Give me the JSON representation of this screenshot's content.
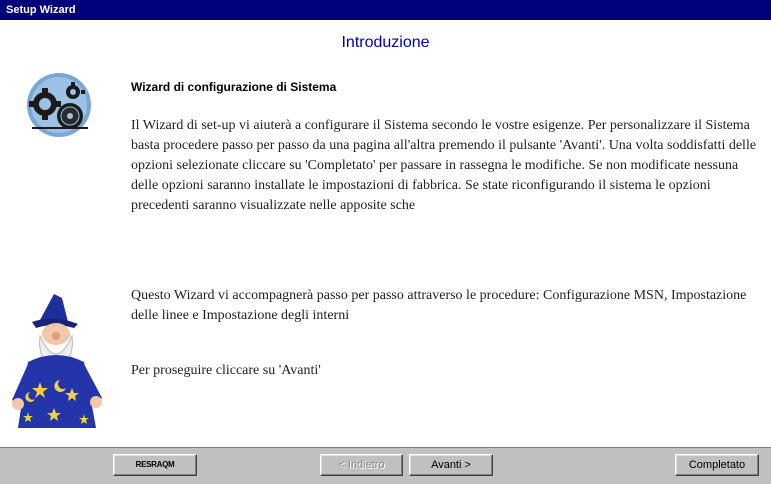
{
  "window": {
    "title": "Setup Wizard"
  },
  "page": {
    "heading": "Introduzione",
    "subtitle": "Wizard di configurazione di Sistema",
    "paragraphs": [
      "Il Wizard di set-up vi aiuterà a configurare il Sistema secondo le vostre esigenze. Per personalizzare il Sistema basta procedere passo per passo da una pagina all'altra premendo il pulsante 'Avanti'.  Una volta soddisfatti delle opzioni selezionate cliccare su 'Completato' per passare in rassegna le modifiche. Se non  modificate nessuna delle opzioni saranno installate le impostazioni di fabbrica. Se state riconfigurando il sistema le opzioni precedenti saranno visualizzate nelle apposite sche",
      "Questo Wizard vi accompagnerà passo per passo attraverso le procedure: Configurazione MSN, Impostazione delle linee e Impostazione degli interni",
      "Per proseguire cliccare su 'Avanti'"
    ]
  },
  "buttons": {
    "logo": "RESRAQM",
    "back": "< Indietro",
    "next": "Avanti >",
    "done": "Completato"
  },
  "icons": {
    "config": "gear-disk-icon",
    "wizard": "wizard-character"
  },
  "colors": {
    "titlebar": "#00007b",
    "heading": "#0000aa",
    "chrome": "#c0c0c0"
  }
}
